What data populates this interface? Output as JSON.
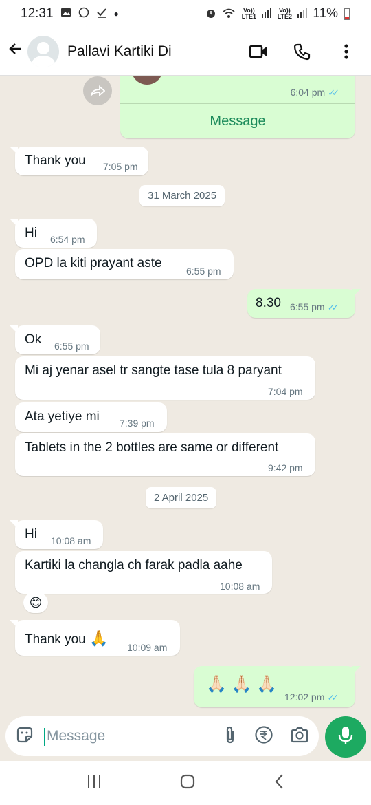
{
  "status_bar": {
    "time": "12:31",
    "sim1_label": "Vo)) LTE1",
    "sim2_label": "Vo)) LTE2",
    "battery_percent": "11%",
    "icons": [
      "gallery-icon",
      "whatsapp-icon",
      "check-icon",
      "dot-icon",
      "alarm-icon",
      "wifi-icon",
      "signal-icon",
      "battery-icon"
    ]
  },
  "header": {
    "contact_name": "Pallavi Kartiki Di",
    "icons": [
      "back-arrow-icon",
      "avatar",
      "video-call-icon",
      "phone-icon",
      "more-vert-icon"
    ]
  },
  "contact_card": {
    "time": "6:04 pm",
    "action_label": "Message"
  },
  "messages": [
    {
      "direction": "in",
      "text": "Thank you",
      "time": "7:05 pm"
    },
    {
      "type": "date",
      "text": "31 March 2025"
    },
    {
      "direction": "in",
      "text": "Hi",
      "time": "6:54 pm"
    },
    {
      "direction": "in",
      "text": "OPD la kiti prayant aste",
      "time": "6:55 pm"
    },
    {
      "direction": "out",
      "text": "8.30",
      "time": "6:55 pm"
    },
    {
      "direction": "in",
      "text": "Ok",
      "time": "6:55 pm"
    },
    {
      "direction": "in",
      "text": "Mi aj yenar asel tr sangte tase tula 8 paryant",
      "time": "7:04 pm"
    },
    {
      "direction": "in",
      "text": "Ata yetiye mi",
      "time": "7:39 pm"
    },
    {
      "direction": "in",
      "text": "Tablets in the 2 bottles are same or different",
      "time": "9:42 pm"
    },
    {
      "type": "date",
      "text": "2 April 2025"
    },
    {
      "direction": "in",
      "text": "Hi",
      "time": "10:08 am"
    },
    {
      "direction": "in",
      "text": "Kartiki la changla ch farak padla aahe",
      "time": "10:08 am",
      "reaction": "😊"
    },
    {
      "direction": "in",
      "text": "Thank you",
      "emoji": "🙏",
      "time": "10:09 am"
    },
    {
      "direction": "out",
      "text": "🙏🏻 🙏🏻 🙏🏻",
      "time": "12:02 pm"
    }
  ],
  "input": {
    "placeholder": "Message",
    "icons": [
      "sticker-icon",
      "attach-icon",
      "rupee-payment-icon",
      "camera-icon",
      "mic-icon"
    ]
  },
  "nav": {
    "icons": [
      "recent-apps-icon",
      "home-icon",
      "back-nav-icon"
    ]
  },
  "colors": {
    "chat_bg": "#efeae2",
    "outgoing_bubble": "#d9fdd3",
    "incoming_bubble": "#ffffff",
    "read_tick": "#53bdeb",
    "accent_green": "#1daa61",
    "link_green": "#1b8a5a"
  }
}
